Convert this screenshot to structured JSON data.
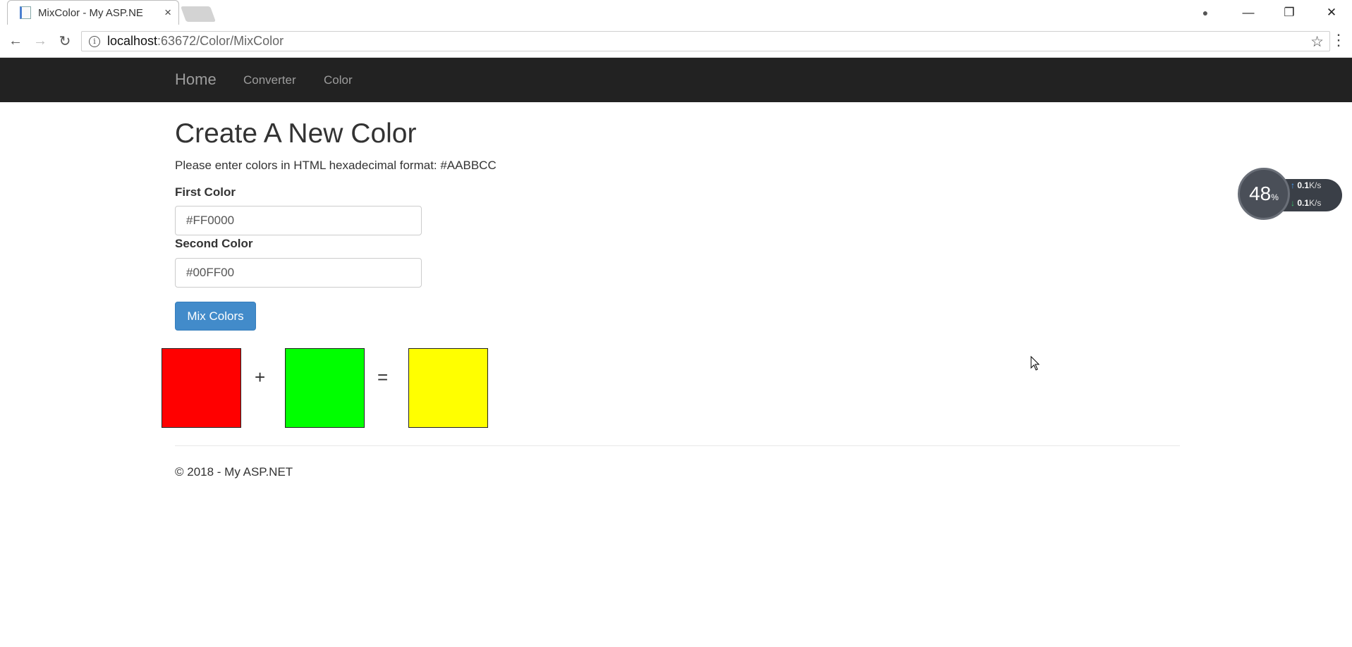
{
  "browser": {
    "tab_title": "MixColor - My ASP.NE",
    "tab_close": "×",
    "url_host": "localhost",
    "url_rest": ":63672/Color/MixColor",
    "back": "←",
    "forward": "→",
    "reload": "↻",
    "star": "☆",
    "menu": "⋮",
    "win_min": "—",
    "win_max": "❐",
    "win_close": "✕",
    "account": "●",
    "info": "i"
  },
  "nav": {
    "brand": "Home",
    "links": [
      "Converter",
      "Color"
    ]
  },
  "page": {
    "heading": "Create A New Color",
    "instructions": "Please enter colors in HTML hexadecimal format: #AABBCC",
    "first_label": "First Color",
    "first_value": "#FF0000",
    "second_label": "Second Color",
    "second_value": "#00FF00",
    "button": "Mix Colors",
    "plus": "+",
    "equals": "=",
    "swatch_colors": [
      "#ff0000",
      "#00ff00",
      "#ffff00"
    ]
  },
  "footer": {
    "text": "© 2018 - My ASP.NET"
  },
  "widget": {
    "percent": "48",
    "percent_sign": "%",
    "up_value": "0.1",
    "up_unit": "K/s",
    "down_value": "0.1",
    "down_unit": "K/s"
  },
  "colors": {
    "navbar": "#222222",
    "button": "#428bca"
  }
}
